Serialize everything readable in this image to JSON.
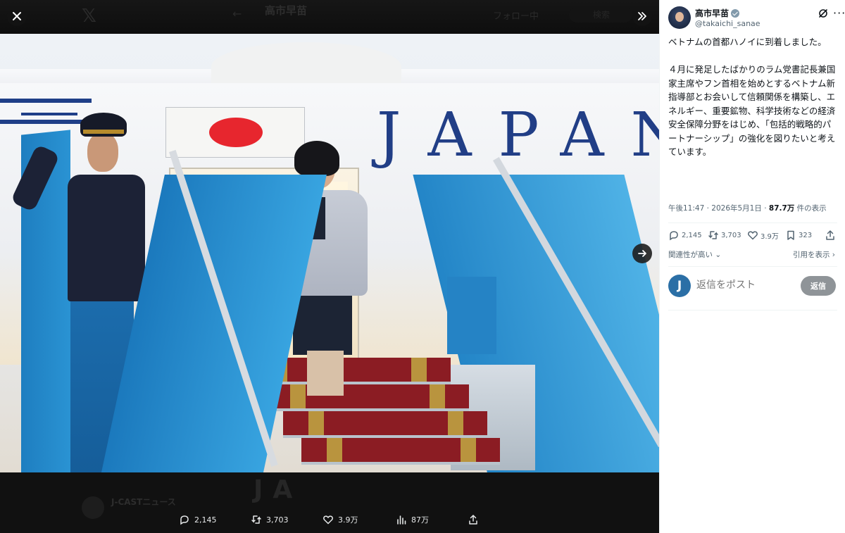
{
  "background_header": {
    "name": "高市早苗",
    "follow_label": "フォロー中",
    "search_placeholder": "検索"
  },
  "background_footer": {
    "photo_text": "JA",
    "source_name": "J-CASTニュース"
  },
  "viewer": {
    "airplane_text": "JAPAN",
    "actions": {
      "replies": "2,145",
      "reposts": "3,703",
      "likes": "3.9万",
      "views": "87万"
    }
  },
  "post": {
    "author_name": "高市早苗",
    "author_handle": "@takaichi_sanae",
    "text": "ベトナムの首都ハノイに到着しました。\n\n４月に発足したばかりのラム党書記長兼国家主席やフン首相を始めとするベトナム新指導部とお会いして信頼関係を構築し、エネルギー、重要鉱物、科学技術などの経済安全保障分野をはじめ、「包括的戦略的パートナーシップ」の強化を図りたいと考えています。",
    "time": "午後11:47",
    "date": "2026年5月1日",
    "views_count": "87.7万",
    "views_label": "件の表示",
    "stats": {
      "replies": "2,145",
      "reposts": "3,703",
      "likes": "3.9万",
      "bookmarks": "323"
    },
    "sort_label": "関連性が高い",
    "quotes_label": "引用を表示"
  },
  "reply_box": {
    "avatar_letter": "J",
    "placeholder": "返信をポスト",
    "button_label": "返信"
  },
  "colors": {
    "accent": "#1d9bf0",
    "reply_button_disabled": "#8f9498",
    "text_primary": "#0f1419",
    "text_secondary": "#536471",
    "flag_red": "#e7262e",
    "livery_blue": "#213e86"
  }
}
